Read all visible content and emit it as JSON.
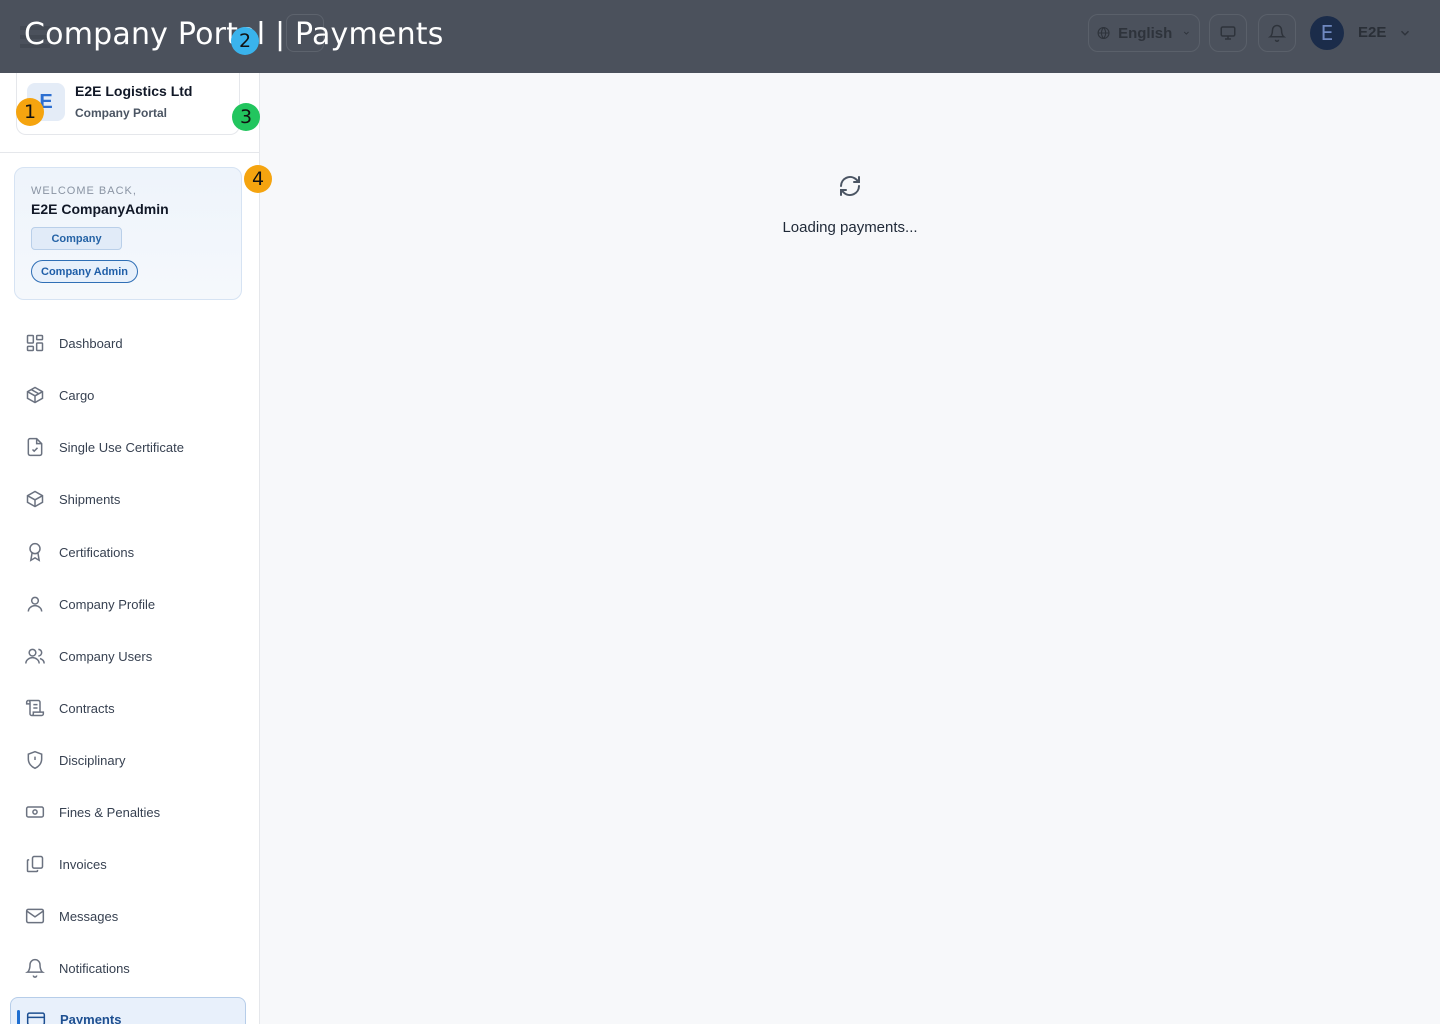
{
  "header": {
    "title": "Company Portal | Payments",
    "language": "English",
    "user_initial": "E",
    "user_name": "E2E"
  },
  "company": {
    "logo_letter": "E",
    "name": "E2E Logistics Ltd",
    "subtitle": "Company Portal"
  },
  "welcome": {
    "label": "WELCOME BACK,",
    "name": "E2E CompanyAdmin",
    "tag_type": "Company",
    "tag_role": "Company Admin"
  },
  "sidebar": {
    "items": [
      {
        "label": "Dashboard",
        "icon": "dashboard-icon"
      },
      {
        "label": "Cargo",
        "icon": "box-icon"
      },
      {
        "label": "Single Use Certificate",
        "icon": "file-check-icon"
      },
      {
        "label": "Shipments",
        "icon": "package-icon"
      },
      {
        "label": "Certifications",
        "icon": "award-icon"
      },
      {
        "label": "Company Profile",
        "icon": "user-icon"
      },
      {
        "label": "Company Users",
        "icon": "users-icon"
      },
      {
        "label": "Contracts",
        "icon": "scroll-icon"
      },
      {
        "label": "Disciplinary",
        "icon": "shield-alert-icon"
      },
      {
        "label": "Fines & Penalties",
        "icon": "banknote-icon"
      },
      {
        "label": "Invoices",
        "icon": "copy-icon"
      },
      {
        "label": "Messages",
        "icon": "mail-icon"
      },
      {
        "label": "Notifications",
        "icon": "bell-icon"
      },
      {
        "label": "Payments",
        "icon": "credit-card-icon",
        "active": true
      }
    ]
  },
  "main": {
    "loading_text": "Loading payments..."
  },
  "markers": {
    "m1": "1",
    "m2": "2",
    "m3": "3",
    "m4": "4"
  },
  "colors": {
    "topbar": "#4b515c",
    "accent": "#1f6fd1",
    "marker_orange": "#f5a40f",
    "marker_blue": "#3ab3ec",
    "marker_green": "#22c55e"
  }
}
